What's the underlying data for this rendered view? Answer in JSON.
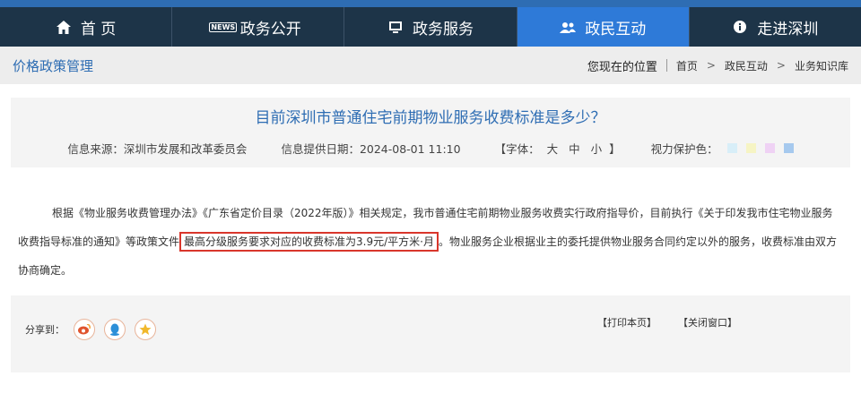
{
  "nav": {
    "items": [
      {
        "label": "首 页",
        "icon": "home-icon"
      },
      {
        "label": "政务公开",
        "icon": "news-icon",
        "icon_text": "NEWS"
      },
      {
        "label": "政务服务",
        "icon": "monitor-icon"
      },
      {
        "label": "政民互动",
        "icon": "people-icon",
        "active": true
      },
      {
        "label": "走进深圳",
        "icon": "info-icon"
      }
    ]
  },
  "breadcrumb": {
    "section_title": "价格政策管理",
    "location_label": "您现在的位置",
    "items": [
      "首页",
      "政民互动",
      "业务知识库"
    ],
    "arrow": ">"
  },
  "article": {
    "title": "目前深圳市普通住宅前期物业服务收费标准是多少？",
    "source": "信息来源：深圳市发展和改革委员会",
    "date": "信息提供日期：2024-08-01 11:10",
    "font_label": "【字体：",
    "font_sizes": [
      "大",
      "中",
      "小"
    ],
    "font_close": "】",
    "eye_care_label": "视力保护色：",
    "eye_care_colors": [
      "#d8eef8",
      "#f6f4c4",
      "#efd2f4",
      "#a6c9ee"
    ],
    "body_before": "根据《物业服务收费管理办法》《广东省定价目录（2022年版）》相关规定，我市普通住宅前期物业服务收费实行政府指导价，目前执行《关于印发我市住宅物业服务收费指导标准的通知》等政策文件",
    "body_highlight": "最高分级服务要求对应的收费标准为3.9元/平方米·月",
    "body_after": "。物业服务企业根据业主的委托提供物业服务合同约定以外的服务，收费标准由双方协商确定。"
  },
  "footer": {
    "share_label": "分享到：",
    "share_icons": [
      "weibo-icon",
      "qq-icon",
      "star-icon"
    ],
    "print": "【打印本页】",
    "close": "【关闭窗口】"
  },
  "colors": {
    "nav_bg": "#1d3448",
    "nav_active": "#2e7ad8",
    "accent": "#2e6db3",
    "highlight_border": "#d9362b"
  }
}
